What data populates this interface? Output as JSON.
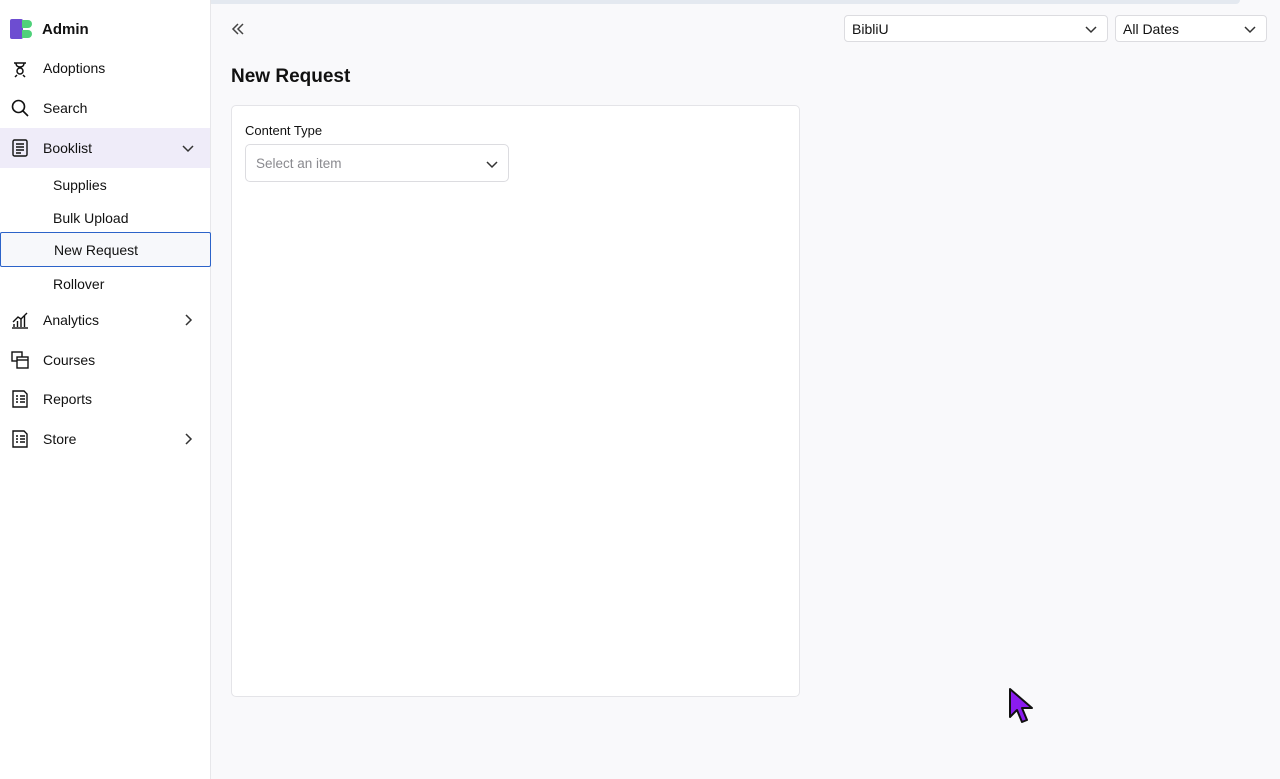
{
  "sidebar": {
    "brand": "Admin",
    "items": [
      {
        "label": "Adoptions",
        "icon": "adoptions-icon"
      },
      {
        "label": "Search",
        "icon": "search-icon"
      },
      {
        "label": "Booklist",
        "icon": "booklist-icon",
        "expanded": true
      },
      {
        "label": "Analytics",
        "icon": "analytics-icon"
      },
      {
        "label": "Courses",
        "icon": "courses-icon"
      },
      {
        "label": "Reports",
        "icon": "reports-icon"
      },
      {
        "label": "Store",
        "icon": "store-icon"
      }
    ],
    "booklist_sub": [
      {
        "label": "Supplies"
      },
      {
        "label": "Bulk Upload"
      },
      {
        "label": "New Request",
        "selected": true
      },
      {
        "label": "Rollover"
      }
    ]
  },
  "header": {
    "org_select": "BibliU",
    "date_select": "All Dates"
  },
  "main": {
    "title": "New Request",
    "form": {
      "content_type_label": "Content Type",
      "content_type_placeholder": "Select an item"
    }
  },
  "colors": {
    "accent": "#6d4dd1",
    "brand_green": "#4fd17a",
    "active_bg": "#efecf9",
    "selected_border": "#2c63c9",
    "cursor": "#8b1cf0"
  }
}
